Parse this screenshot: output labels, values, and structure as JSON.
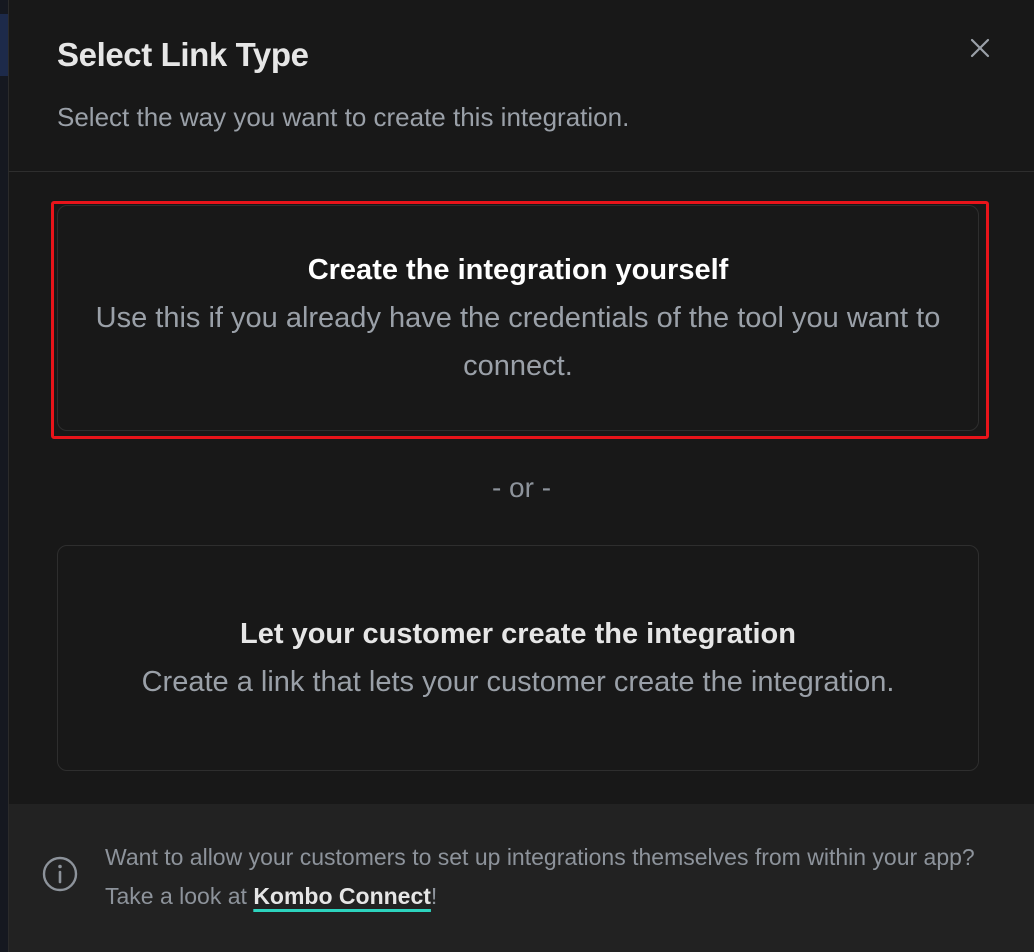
{
  "dialog": {
    "title": "Select Link Type",
    "subtitle": "Select the way you want to create this integration.",
    "close_icon": "close-icon"
  },
  "options": [
    {
      "title": "Create the integration yourself",
      "description": "Use this if you already have the credentials of the tool you want to connect.",
      "highlighted": true
    },
    {
      "title": "Let your customer create the integration",
      "description": "Create a link that lets your customer create the integration.",
      "highlighted": false
    }
  ],
  "divider_text": "- or -",
  "footer": {
    "icon": "info-icon",
    "text_before": "Want to allow your customers to set up integrations themselves from within your app? Take a look at ",
    "link_text": "Kombo Connect",
    "text_after": "!"
  },
  "colors": {
    "highlight": "#e8141a",
    "link_underline": "#2dd4bf",
    "dialog_bg": "#181818",
    "footer_bg": "#222222"
  }
}
